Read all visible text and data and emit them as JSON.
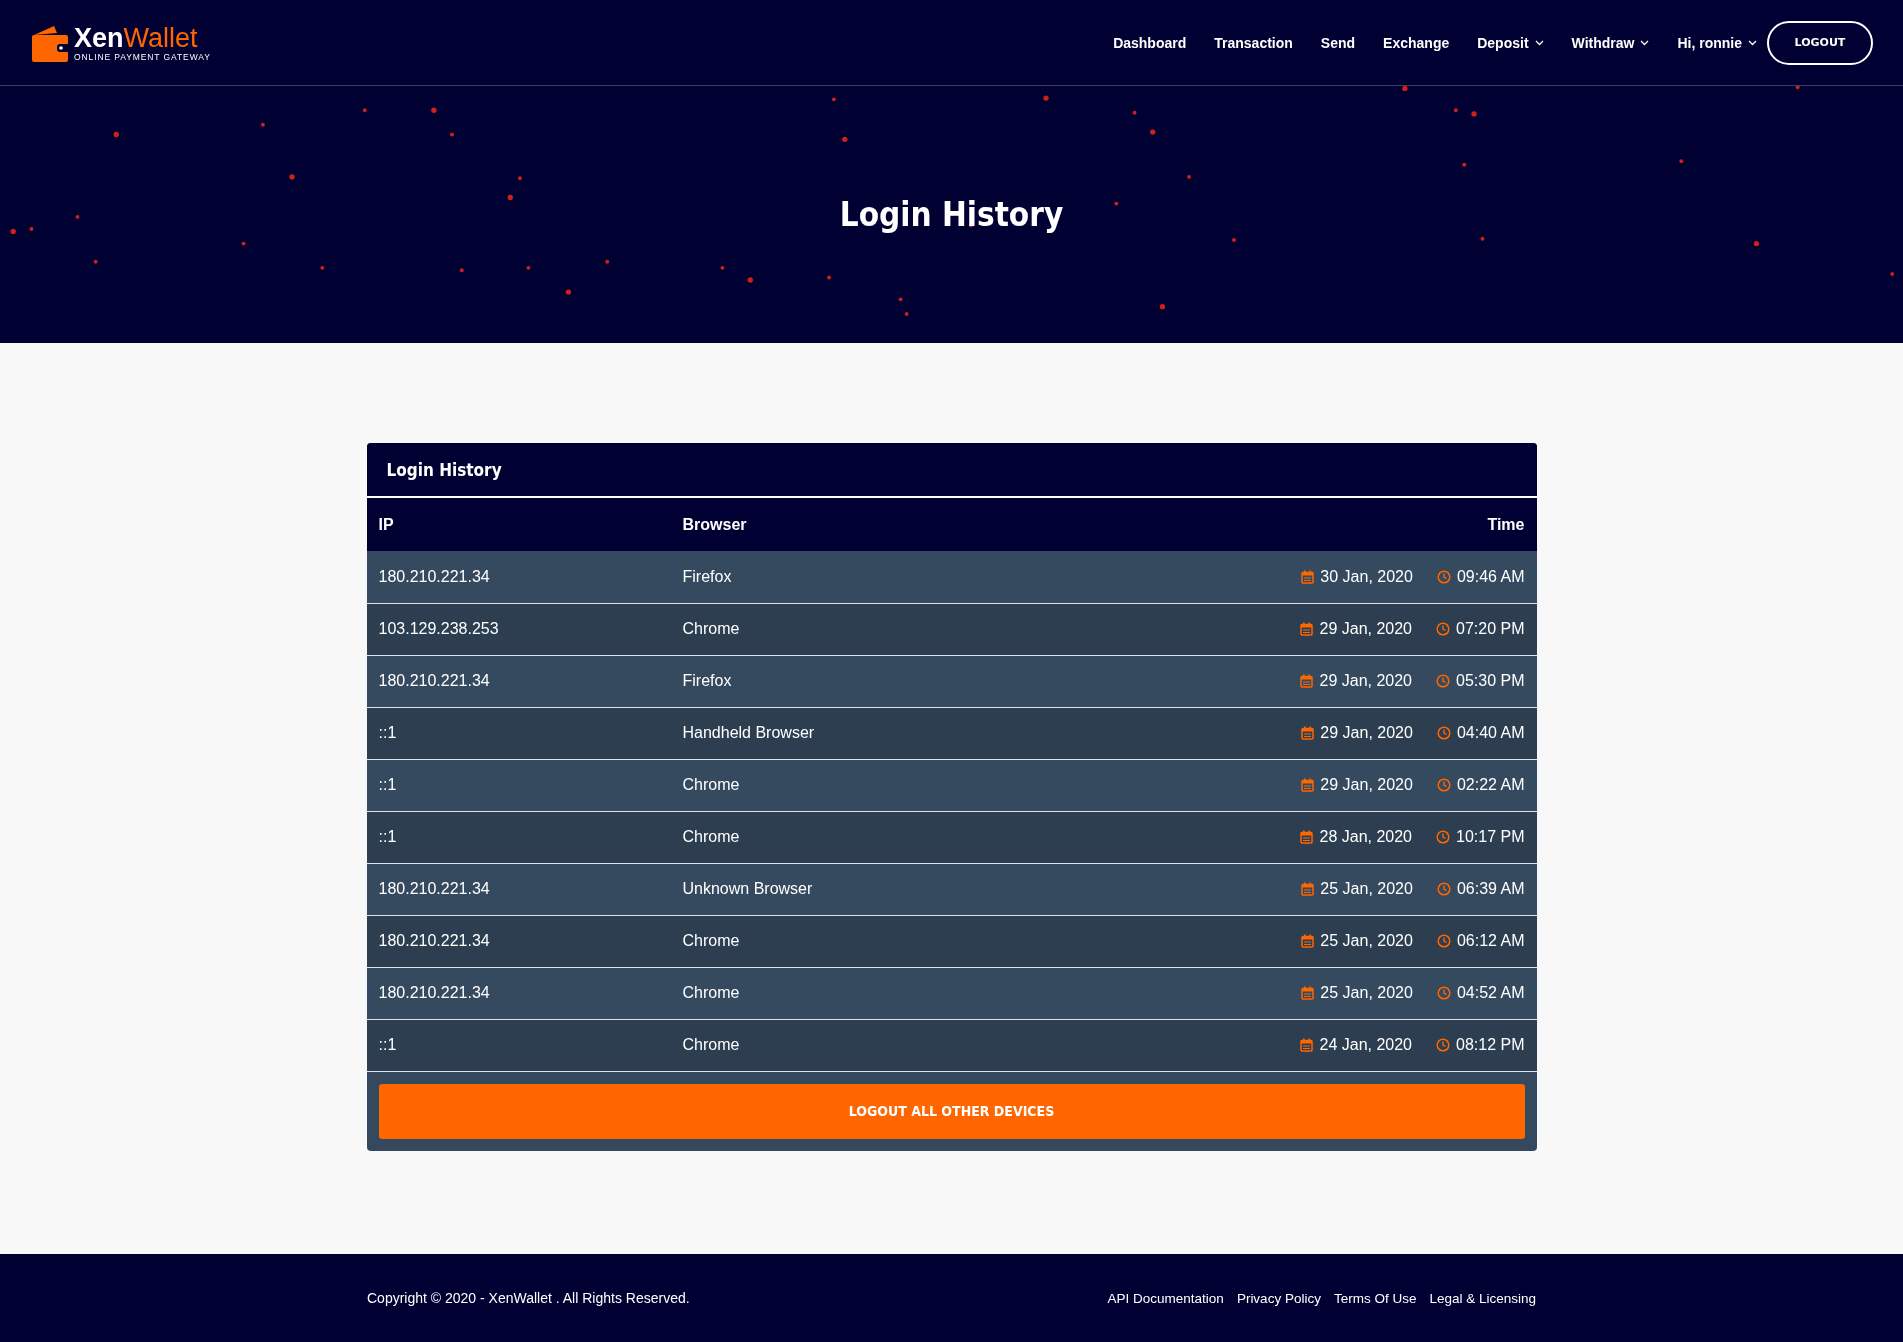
{
  "header": {
    "logo": {
      "name_first": "Xen",
      "name_second": "Wallet",
      "tagline": "ONLINE PAYMENT GATEWAY"
    },
    "nav": [
      {
        "label": "Dashboard",
        "dropdown": false
      },
      {
        "label": "Transaction",
        "dropdown": false
      },
      {
        "label": "Send",
        "dropdown": false
      },
      {
        "label": "Exchange",
        "dropdown": false
      },
      {
        "label": "Deposit",
        "dropdown": true
      },
      {
        "label": "Withdraw",
        "dropdown": true
      },
      {
        "label": "Hi, ronnie",
        "dropdown": true
      }
    ],
    "logout_button": "LOGOUT"
  },
  "hero": {
    "title": "Login History"
  },
  "card": {
    "title": "Login History",
    "table": {
      "columns": [
        "IP",
        "Browser",
        "Time"
      ],
      "rows": [
        {
          "ip": "180.210.221.34",
          "browser": "Firefox",
          "date": "30 Jan, 2020",
          "time": "09:46 AM"
        },
        {
          "ip": "103.129.238.253",
          "browser": "Chrome",
          "date": "29 Jan, 2020",
          "time": "07:20 PM"
        },
        {
          "ip": "180.210.221.34",
          "browser": "Firefox",
          "date": "29 Jan, 2020",
          "time": "05:30 PM"
        },
        {
          "ip": "::1",
          "browser": "Handheld Browser",
          "date": "29 Jan, 2020",
          "time": "04:40 AM"
        },
        {
          "ip": "::1",
          "browser": "Chrome",
          "date": "29 Jan, 2020",
          "time": "02:22 AM"
        },
        {
          "ip": "::1",
          "browser": "Chrome",
          "date": "28 Jan, 2020",
          "time": "10:17 PM"
        },
        {
          "ip": "180.210.221.34",
          "browser": "Unknown Browser",
          "date": "25 Jan, 2020",
          "time": "06:39 AM"
        },
        {
          "ip": "180.210.221.34",
          "browser": "Chrome",
          "date": "25 Jan, 2020",
          "time": "06:12 AM"
        },
        {
          "ip": "180.210.221.34",
          "browser": "Chrome",
          "date": "25 Jan, 2020",
          "time": "04:52 AM"
        },
        {
          "ip": "::1",
          "browser": "Chrome",
          "date": "24 Jan, 2020",
          "time": "08:12 PM"
        }
      ]
    },
    "action_button": "LOGOUT ALL OTHER DEVICES"
  },
  "footer": {
    "copyright": "Copyright © 2020 - XenWallet . All Rights Reserved.",
    "links": [
      "API Documentation",
      "Privacy Policy",
      "Terms Of Use",
      "Legal & Licensing"
    ]
  }
}
